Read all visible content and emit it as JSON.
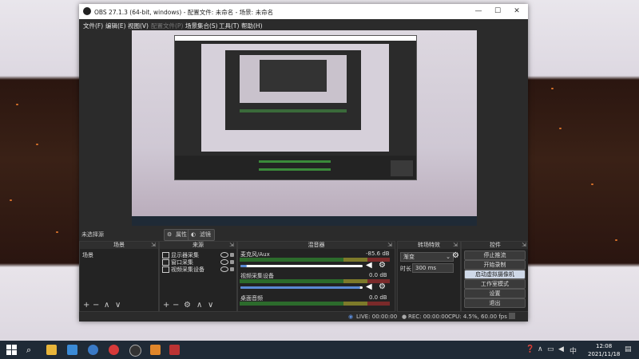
{
  "window": {
    "title": "OBS 27.1.3 (64-bit, windows) - 配置文件: 未命名 - 场景: 未命名",
    "minimize": "—",
    "maximize": "☐",
    "close": "✕"
  },
  "menu": [
    "文件(F)",
    "编辑(E)",
    "视图(V)",
    "配置文件(P)",
    "场景集合(S)",
    "工具(T)",
    "帮助(H)"
  ],
  "preview_bar": {
    "selection": "未选择源",
    "properties": "属性",
    "filters": "滤镜"
  },
  "scenes": {
    "header": "场景",
    "items": [
      "场景"
    ]
  },
  "sources": {
    "header": "来源",
    "items": [
      "显示器采集",
      "窗口采集",
      "视频采集设备"
    ]
  },
  "mixer": {
    "header": "混音器",
    "channels": [
      {
        "name": "麦克风/Aux",
        "db": "-85.6 dB"
      },
      {
        "name": "视频采集设备",
        "db": "0.0 dB"
      },
      {
        "name": "桌面音频",
        "db": "0.0 dB"
      }
    ]
  },
  "transitions": {
    "header": "转场特效",
    "type": "渐变",
    "duration_label": "时长",
    "duration_value": "300 ms"
  },
  "controls": {
    "header": "控件",
    "buttons": [
      "停止推流",
      "开始录制",
      "启动虚拟摄像机",
      "工作室模式",
      "设置",
      "退出"
    ],
    "highlighted_index": 2
  },
  "status": {
    "live": "LIVE: 00:00:00",
    "rec": "REC: 00:00:00",
    "cpu": "CPU: 4.5%, 60.00 fps"
  },
  "taskbar": {
    "time": "12:08",
    "date": "2021/11/18",
    "lang": "中"
  },
  "colors": {
    "accent": "#5a8ad6",
    "meter_green": "#4cd14c",
    "panel_bg": "#232323",
    "window_bg": "#2b2b2b"
  }
}
